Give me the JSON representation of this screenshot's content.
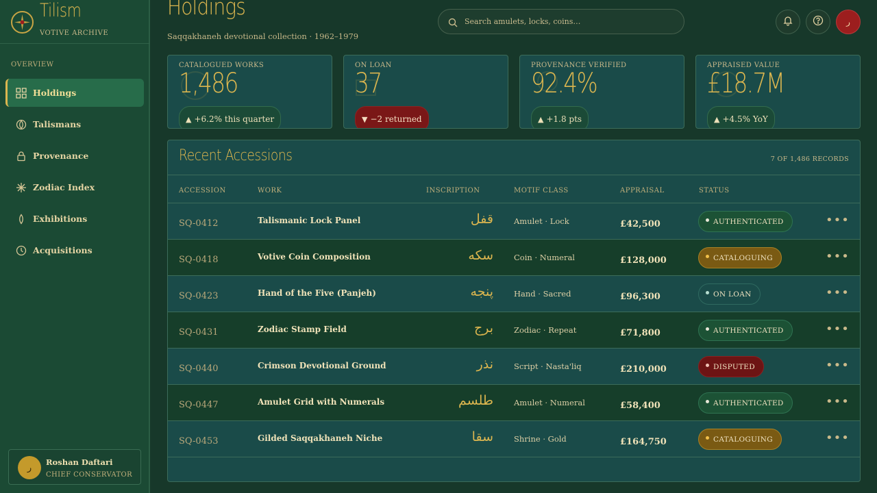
{
  "app": {
    "name": "Tilism",
    "subtitle": "VOTIVE ARCHIVE"
  },
  "nav": {
    "heading": "OVERVIEW",
    "items": [
      {
        "label": "Holdings",
        "icon": "grid-icon"
      },
      {
        "label": "Talismans",
        "icon": "talisman-icon"
      },
      {
        "label": "Provenance",
        "icon": "lock-icon"
      },
      {
        "label": "Zodiac Index",
        "icon": "star-burst-icon"
      },
      {
        "label": "Exhibitions",
        "icon": "flame-icon"
      },
      {
        "label": "Acquisitions",
        "icon": "clock-icon"
      }
    ]
  },
  "user": {
    "name": "Roshan Daftari",
    "role": "CHIEF CONSERVATOR",
    "initial": "ر"
  },
  "header": {
    "title": "Holdings",
    "subtitle": "Saqqakhaneh devotional collection · 1962–1979",
    "search_placeholder": "Search amulets, locks, coins…",
    "avatar_initial": "ر"
  },
  "stats": [
    {
      "label": "CATALOGUED WORKS",
      "value": "1,486",
      "delta": "+6.2% this quarter",
      "direction": "up"
    },
    {
      "label": "ON LOAN",
      "value": "37",
      "delta": "−2 returned",
      "direction": "down"
    },
    {
      "label": "PROVENANCE VERIFIED",
      "value": "92.4%",
      "delta": "+1.8 pts",
      "direction": "up"
    },
    {
      "label": "APPRAISED VALUE",
      "value": "£18.7M",
      "delta": "+4.5% YoY",
      "direction": "up"
    }
  ],
  "table": {
    "title": "Recent Accessions",
    "count": "7 OF 1,486 RECORDS",
    "columns": [
      "ACCESSION",
      "WORK",
      "INSCRIPTION",
      "MOTIF CLASS",
      "APPRAISAL",
      "STATUS"
    ],
    "rows": [
      {
        "accession": "SQ-0412",
        "work": "Talismanic Lock Panel",
        "inscription": "قفل",
        "motif": "Amulet · Lock",
        "appraisal": "£42,500",
        "status": "AUTHENTICATED",
        "status_kind": "auth"
      },
      {
        "accession": "SQ-0418",
        "work": "Votive Coin Composition",
        "inscription": "سکه",
        "motif": "Coin · Numeral",
        "appraisal": "£128,000",
        "status": "CATALOGUING",
        "status_kind": "cat"
      },
      {
        "accession": "SQ-0423",
        "work": "Hand of the Five (Panjeh)",
        "inscription": "پنجه",
        "motif": "Hand · Sacred",
        "appraisal": "£96,300",
        "status": "ON LOAN",
        "status_kind": "loan"
      },
      {
        "accession": "SQ-0431",
        "work": "Zodiac Stamp Field",
        "inscription": "برج",
        "motif": "Zodiac · Repeat",
        "appraisal": "£71,800",
        "status": "AUTHENTICATED",
        "status_kind": "auth"
      },
      {
        "accession": "SQ-0440",
        "work": "Crimson Devotional Ground",
        "inscription": "نذر",
        "motif": "Script · Nasta'liq",
        "appraisal": "£210,000",
        "status": "DISPUTED",
        "status_kind": "disp"
      },
      {
        "accession": "SQ-0447",
        "work": "Amulet Grid with Numerals",
        "inscription": "طلسم",
        "motif": "Amulet · Numeral",
        "appraisal": "£58,400",
        "status": "AUTHENTICATED",
        "status_kind": "auth"
      },
      {
        "accession": "SQ-0453",
        "work": "Gilded Saqqakhaneh Niche",
        "inscription": "سقا",
        "motif": "Shrine · Gold",
        "appraisal": "£164,750",
        "status": "CATALOGUING",
        "status_kind": "cat"
      }
    ]
  },
  "colors": {
    "gold": "#dcb64f",
    "sidebar": "#1b4a34",
    "panel": "#1a4b49",
    "crimson": "#9c1e1e"
  }
}
